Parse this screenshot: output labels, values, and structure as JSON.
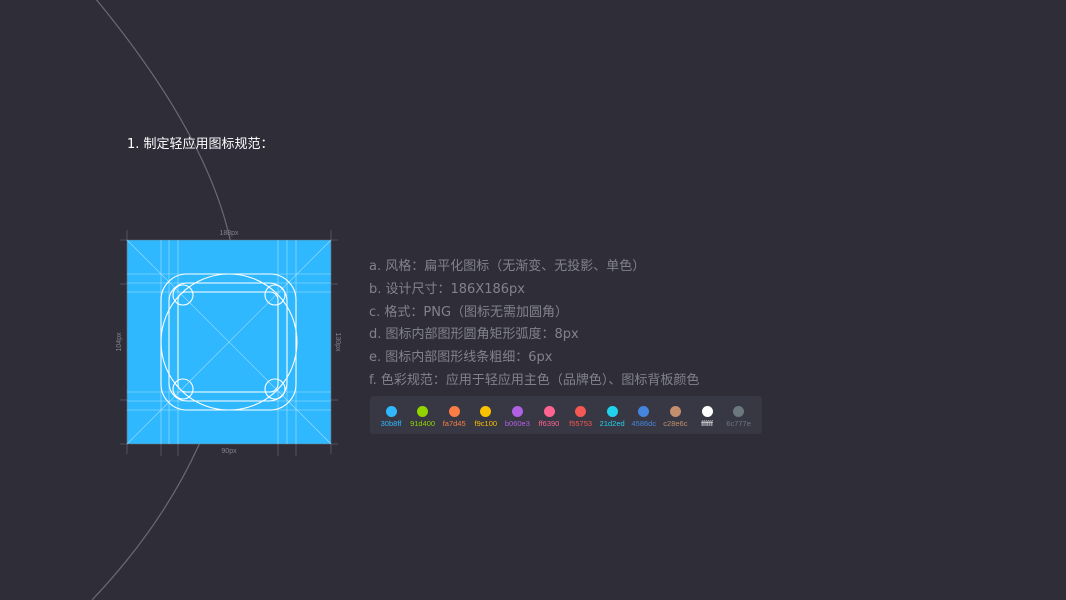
{
  "page": {
    "title": "1. 制定轻应用图标规范："
  },
  "guide": {
    "top_dimension": "188px",
    "bottom_dimension": "90px",
    "left_dimension": "104px",
    "right_dimension": "130px",
    "fill_color": "#30b8ff"
  },
  "specs": [
    "a. 风格：扁平化图标（无渐变、无投影、单色）",
    "b. 设计尺寸：186X186px",
    "c. 格式：PNG（图标无需加圆角）",
    "d. 图标内部图形圆角矩形弧度：8px",
    "e. 图标内部图形线条粗细：6px",
    "f. 色彩规范：应用于轻应用主色（品牌色）、图标背板颜色"
  ],
  "palette": [
    {
      "label": "30b8ff",
      "color": "#30b8ff"
    },
    {
      "label": "91d400",
      "color": "#91d400"
    },
    {
      "label": "fa7d45",
      "color": "#fa7d45"
    },
    {
      "label": "f9c100",
      "color": "#f9c100"
    },
    {
      "label": "b060e3",
      "color": "#b060e3"
    },
    {
      "label": "ff6390",
      "color": "#ff6390"
    },
    {
      "label": "f55753",
      "color": "#f55753"
    },
    {
      "label": "21d2ed",
      "color": "#21d2ed"
    },
    {
      "label": "4586dc",
      "color": "#4586dc"
    },
    {
      "label": "c28e6c",
      "color": "#c28e6c"
    },
    {
      "label": "ffffff",
      "color": "#ffffff"
    },
    {
      "label": "6c777e",
      "color": "#6c777e"
    }
  ]
}
